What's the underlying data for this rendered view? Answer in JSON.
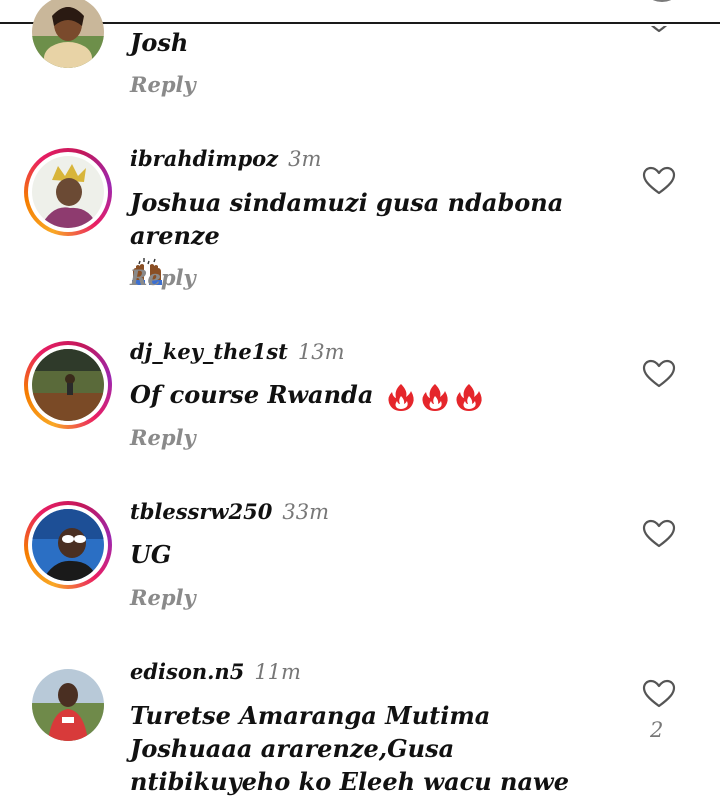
{
  "colors": {
    "ring_start": "#f9a825",
    "ring_mid": "#e91e63",
    "ring_end": "#9c27b0",
    "meta_gray": "#777777",
    "reply_gray": "#8a8a8a",
    "text": "#111111"
  },
  "comments": [
    {
      "username": "",
      "time": "",
      "text": "Josh",
      "reply": "Reply",
      "likes": "",
      "avatar_icon": "user-photo-avatar",
      "story_ring": false
    },
    {
      "username": "ibrahdimpoz",
      "time": "3m",
      "text": "Joshua sindamuzi gusa ndabona arenze",
      "emoji": "raised-hands-icon",
      "reply": "Reply",
      "likes": "",
      "avatar_icon": "user-photo-avatar",
      "story_ring": true
    },
    {
      "username": "dj_key_the1st",
      "time": "13m",
      "text": "Of course Rwanda",
      "emoji": "fire-icon",
      "reply": "Reply",
      "likes": "",
      "avatar_icon": "user-photo-avatar",
      "story_ring": true
    },
    {
      "username": "tblessrw250",
      "time": "33m",
      "text": "UG",
      "reply": "Reply",
      "likes": "",
      "avatar_icon": "user-photo-avatar",
      "story_ring": true
    },
    {
      "username": "edison.n5",
      "time": "11m",
      "text": "Turetse Amaranga Mutima Joshuaaa ararenze,Gusa ntibikuyeho ko Eleeh wacu nawe abizi.",
      "reply": "",
      "likes": "2",
      "avatar_icon": "user-photo-avatar",
      "story_ring": false
    }
  ],
  "icons": {
    "like": "heart-outline-icon"
  }
}
